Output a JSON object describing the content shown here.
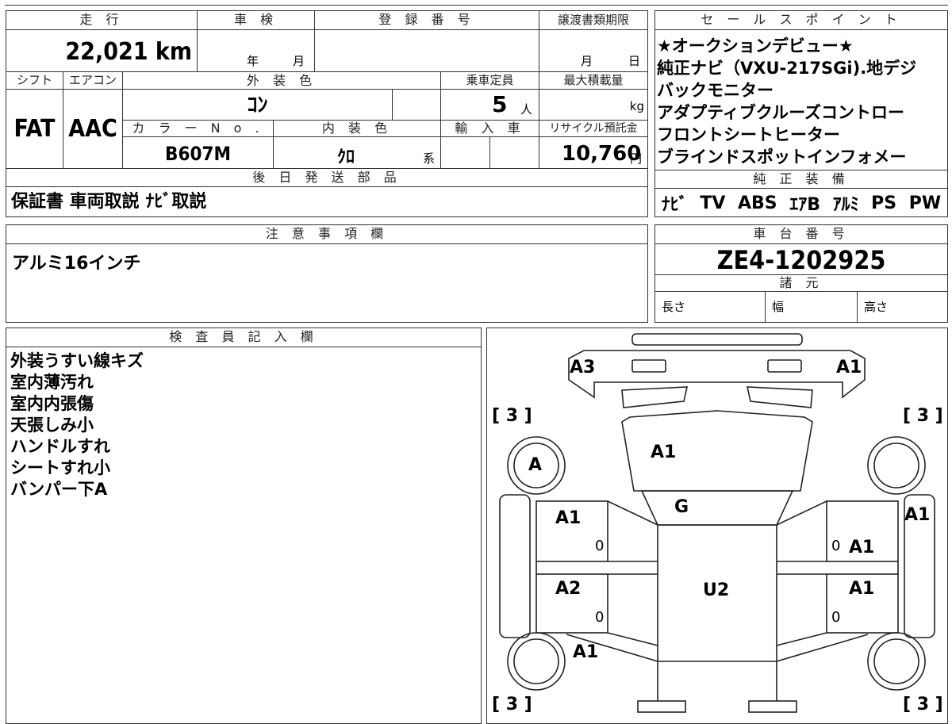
{
  "headers": {
    "mileage": "走 行",
    "inspection": "車 検",
    "registration": "登 録 番 号",
    "transfer_deadline": "譲渡書類期限",
    "shift": "シフト",
    "aircon": "エアコン",
    "exterior_color": "外 装 色",
    "capacity": "乗車定員",
    "max_load": "最大積載量",
    "color_no": "カ ラ ー N o .",
    "interior_color": "内 装 色",
    "import": "輸 入 車",
    "recycle": "リサイクル預託金",
    "later_parts": "後 日 発 送 部 品",
    "sales_points": "セ ー ル ス ポ イ ン ト",
    "standard_equipment": "純 正 装 備",
    "notes": "注 意 事 項 欄",
    "chassis_no": "車 台 番 号",
    "specs": "諸 元",
    "inspector": "検 査 員 記 入 欄"
  },
  "values": {
    "mileage": "22,021 km",
    "insp_year": "年",
    "insp_month": "月",
    "transfer_month": "月",
    "transfer_day": "日",
    "shift": "FAT",
    "aircon": "AAC",
    "exterior_color": "ｺﾝ",
    "capacity_num": "5",
    "capacity_unit": "人",
    "max_load_unit": "kg",
    "color_no": "B607M",
    "interior_color": "ｸﾛ",
    "interior_suffix": "系",
    "recycle_amount": "10,760",
    "recycle_unit": "円",
    "later_parts": "保証書 車両取説 ﾅﾋﾞ取説",
    "notes": "アルミ16インチ",
    "chassis_no": "ZE4-1202925",
    "spec_length": "長さ",
    "spec_width": "幅",
    "spec_height": "高さ"
  },
  "sales_points": [
    "★オークションデビュー★",
    "純正ナビ（VXU-217SGi).地デジ",
    "バックモニター",
    "アダプティブクルーズコントロー",
    "フロントシートヒーター",
    "ブラインドスポットインフォメー"
  ],
  "standard_equipment": [
    "ﾅﾋﾞ",
    "TV",
    "ABS",
    "ｴｱB",
    "ｱﾙﾐ",
    "PS",
    "PW"
  ],
  "inspector_notes": [
    "外装うすい線キズ",
    "室内薄汚れ",
    "室内内張傷",
    "天張しみ小",
    "ハンドルすれ",
    "シートすれ小",
    "バンパー下A"
  ],
  "diagram": {
    "front_left": "A3",
    "front_right": "A1",
    "hood": "A1",
    "windshield": "G",
    "roof": "U2",
    "left_front_door": "A1",
    "left_rear_door": "A2",
    "right_front_door": "A1",
    "right_rear_door": "A1",
    "right_fender": "A1",
    "left_rear_quarter": "A1",
    "wheel_front_left": "A",
    "tire_fl": "[ 3 ]",
    "tire_fr": "[ 3 ]",
    "tire_rl": "[ 3 ]",
    "tire_rr": "[ 3 ]",
    "door_zero_lf": "0",
    "door_zero_lr": "0",
    "door_zero_rf": "0",
    "door_zero_rr": "0"
  }
}
